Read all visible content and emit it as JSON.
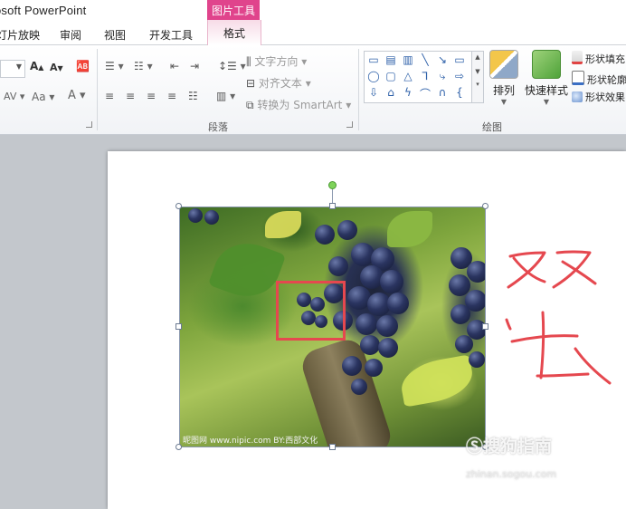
{
  "app_title": "osoft PowerPoint",
  "context_tool": "图片工具",
  "tabs": [
    "灯片放映",
    "审阅",
    "视图",
    "开发工具"
  ],
  "context_tab": "格式",
  "font_group": {
    "grow": "A",
    "shrink": "A",
    "spacing": "AV",
    "case": "Aa",
    "color": "A"
  },
  "paragraph": {
    "text_direction": "文字方向",
    "align_text": "对齐文本",
    "convert_smartart": "转换为 SmartArt",
    "label": "段落"
  },
  "drawing": {
    "arrange": "排列",
    "quick_styles": "快速样式",
    "shape_fill": "形状填充",
    "shape_outline": "形状轮廓",
    "shape_effects": "形状效果",
    "label": "绘图"
  },
  "slide": {
    "photo_watermark": "昵图网 www.nipic.com   BY:西部文化",
    "annotation_strokes": "双击"
  },
  "watermark": {
    "main": "搜狗指南",
    "sub": "zhinan.sogou.com"
  },
  "colors": {
    "context_accent": "#e0448c",
    "annotation_red": "#e5484f",
    "rotation_handle": "#7ed35a"
  }
}
